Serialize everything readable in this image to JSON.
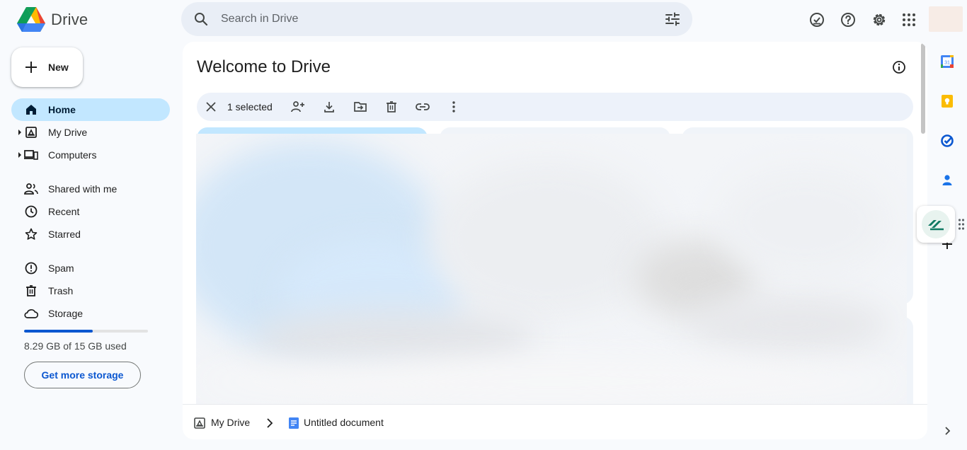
{
  "app": {
    "name": "Drive",
    "logo_icon": "google-drive-logo",
    "colors": {
      "brand_blue": "#0b57d0",
      "active_nav": "#c2e7ff",
      "search_bg": "#e9eef6",
      "selection_bar": "#edf2fa"
    }
  },
  "search": {
    "placeholder": "Search in Drive",
    "value": ""
  },
  "header_icons": [
    "ready-for-offline-icon",
    "help-icon",
    "settings-icon",
    "apps-grid-icon",
    "account-avatar"
  ],
  "sidebar": {
    "new_label": "New",
    "items": [
      {
        "label": "Home",
        "icon": "home-icon",
        "active": true
      },
      {
        "label": "My Drive",
        "icon": "my-drive-icon"
      },
      {
        "label": "Computers",
        "icon": "computers-icon"
      },
      {
        "label": "Shared with me",
        "icon": "shared-icon"
      },
      {
        "label": "Recent",
        "icon": "clock-icon"
      },
      {
        "label": "Starred",
        "icon": "star-icon"
      },
      {
        "label": "Spam",
        "icon": "spam-icon"
      },
      {
        "label": "Trash",
        "icon": "trash-icon"
      },
      {
        "label": "Storage",
        "icon": "cloud-icon"
      }
    ],
    "storage": {
      "used_text": "8.29 GB of 15 GB used",
      "used_fraction": 0.553,
      "button_label": "Get more storage"
    }
  },
  "main": {
    "title": "Welcome to Drive",
    "selection": {
      "count_text": "1 selected",
      "actions": [
        "share-icon",
        "download-icon",
        "move-icon",
        "trash-icon",
        "link-icon",
        "more-icon"
      ]
    }
  },
  "breadcrumb": {
    "items": [
      {
        "label": "My Drive",
        "icon": "my-drive-icon"
      },
      {
        "label": "Untitled document",
        "icon": "docs-icon"
      }
    ]
  },
  "right_rail": [
    "calendar-icon",
    "keep-icon",
    "tasks-icon",
    "contacts-icon",
    "add-ons-icon"
  ]
}
